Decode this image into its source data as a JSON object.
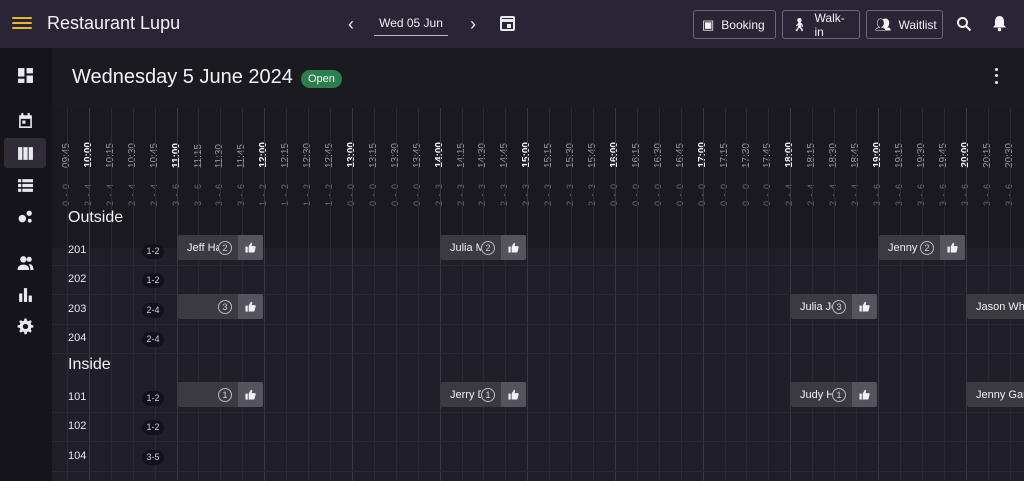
{
  "app": {
    "title": "Restaurant Lupu"
  },
  "date_nav": {
    "value": "Wed 05 Jun",
    "prev_icon": "chevron-left-icon",
    "next_icon": "chevron-right-icon",
    "calendar_icon": "calendar-icon"
  },
  "toolbar": {
    "booking_label": "Booking",
    "walkin_label": "Walk-in",
    "waitlist_label": "Waitlist",
    "booking_icon": "calendar-check-icon",
    "walkin_icon": "walking-person-icon",
    "waitlist_icon": "people-icon",
    "search_icon": "search-icon",
    "notification_icon": "bell-icon"
  },
  "colors": {
    "accent": "#e6b440",
    "open_badge": "#2e7d4f",
    "topbar": "#2a2534"
  },
  "sidebar": {
    "items": [
      {
        "name": "dashboard-icon",
        "active": false
      },
      {
        "name": "calendar-icon",
        "active": false
      },
      {
        "name": "timeline-icon",
        "active": true
      },
      {
        "name": "list-icon",
        "active": false
      },
      {
        "name": "floorplan-icon",
        "active": false
      },
      {
        "name": "guests-icon",
        "active": false
      },
      {
        "name": "reports-icon",
        "active": false
      },
      {
        "name": "settings-icon",
        "active": false
      }
    ]
  },
  "page": {
    "title": "Wednesday 5 June 2024",
    "status": "Open"
  },
  "timeline": {
    "times": [
      "09:45",
      "10:00",
      "10:15",
      "10:30",
      "10:45",
      "11:00",
      "11:15",
      "11:30",
      "11:45",
      "12:00",
      "12:15",
      "12:30",
      "12:45",
      "13:00",
      "13:15",
      "13:30",
      "13:45",
      "14:00",
      "14:15",
      "14:30",
      "14:45",
      "15:00",
      "15:15",
      "15:30",
      "15:45",
      "16:00",
      "16:15",
      "16:30",
      "16:45",
      "17:00",
      "17:15",
      "17:30",
      "17:45",
      "18:00",
      "18:15",
      "18:30",
      "18:45",
      "19:00",
      "19:15",
      "19:30",
      "19:45",
      "20:00",
      "20:15",
      "20:30"
    ],
    "covers": [
      "0 - 0",
      "2 - 4",
      "2 - 4",
      "2 - 4",
      "2 - 4",
      "3 - 6",
      "3 - 6",
      "3 - 6",
      "3 - 6",
      "1 - 2",
      "1 - 2",
      "1 - 2",
      "1 - 2",
      "0 - 0",
      "0 - 0",
      "0 - 0",
      "0 - 0",
      "2 - 3",
      "2 - 3",
      "2 - 3",
      "2 - 3",
      "2 - 3",
      "2 - 3",
      "2 - 3",
      "2 - 3",
      "0 - 0",
      "0 - 0",
      "0 - 0",
      "0 - 0",
      "0 - 0",
      "0 - 0",
      "0 - 0",
      "0 - 0",
      "2 - 4",
      "2 - 4",
      "2 - 4",
      "2 - 4",
      "3 - 6",
      "3 - 6",
      "3 - 6",
      "3 - 6",
      "3 - 6",
      "3 - 6",
      "3 - 6"
    ]
  },
  "sections": [
    {
      "title": "Outside",
      "tables": [
        {
          "name": "201",
          "capacity": "1-2"
        },
        {
          "name": "202",
          "capacity": "1-2"
        },
        {
          "name": "203",
          "capacity": "2-4"
        },
        {
          "name": "204",
          "capacity": "2-4"
        }
      ]
    },
    {
      "title": "Inside",
      "tables": [
        {
          "name": "101",
          "capacity": "1-2"
        },
        {
          "name": "102",
          "capacity": "1-2"
        },
        {
          "name": "104",
          "capacity": "3-5"
        }
      ]
    }
  ],
  "bookings": [
    {
      "guest": "Jeff Harris",
      "party": "2",
      "section": 0,
      "row": 0,
      "start": "11:00",
      "end": "12:00"
    },
    {
      "guest": "Julia Martinez",
      "party": "2",
      "section": 0,
      "row": 0,
      "start": "14:00",
      "end": "15:00"
    },
    {
      "guest": "Jenny Anderson",
      "party": "2",
      "section": 0,
      "row": 0,
      "start": "19:00",
      "end": "20:00"
    },
    {
      "guest": "",
      "party": "3",
      "section": 0,
      "row": 2,
      "start": "11:00",
      "end": "12:00"
    },
    {
      "guest": "Julia Johnson",
      "party": "3",
      "section": 0,
      "row": 2,
      "start": "18:00",
      "end": "19:00"
    },
    {
      "guest": "Jason White",
      "party": "",
      "section": 0,
      "row": 2,
      "start": "20:00",
      "end": "21:00"
    },
    {
      "guest": "",
      "party": "1",
      "section": 1,
      "row": 0,
      "start": "11:00",
      "end": "12:00"
    },
    {
      "guest": "Jerry Davis",
      "party": "1",
      "section": 1,
      "row": 0,
      "start": "14:00",
      "end": "15:00"
    },
    {
      "guest": "Judy Harris",
      "party": "1",
      "section": 1,
      "row": 0,
      "start": "18:00",
      "end": "19:00"
    },
    {
      "guest": "Jenny Garcia",
      "party": "",
      "section": 1,
      "row": 0,
      "start": "20:00",
      "end": "21:00"
    }
  ]
}
